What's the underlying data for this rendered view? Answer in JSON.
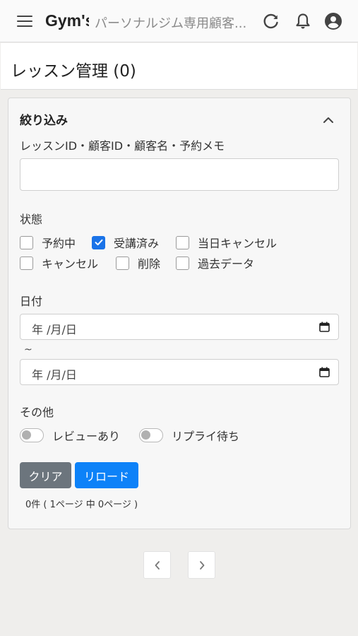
{
  "header": {
    "brand": "Gym's",
    "subtitle": "パーソナルジム専用顧客...",
    "icons": [
      "menu-icon",
      "reload-icon",
      "bell-icon",
      "account-icon"
    ]
  },
  "page": {
    "title": "レッスン管理 (0)"
  },
  "filter": {
    "heading": "絞り込み",
    "search_label": "レッスンID・顧客ID・顧客名・予約メモ",
    "search_value": "",
    "status_label": "状態",
    "statuses": [
      {
        "label": "予約中",
        "checked": false
      },
      {
        "label": "受講済み",
        "checked": true
      },
      {
        "label": "当日キャンセル",
        "checked": false
      },
      {
        "label": "キャンセル",
        "checked": false
      },
      {
        "label": "削除",
        "checked": false
      },
      {
        "label": "過去データ",
        "checked": false
      }
    ],
    "date_label": "日付",
    "date_from_placeholder": "年 /月/日",
    "date_separator": "~",
    "date_to_placeholder": "年 /月/日",
    "other_label": "その他",
    "toggles": [
      {
        "label": "レビューあり",
        "on": false
      },
      {
        "label": "リプライ待ち",
        "on": false
      }
    ],
    "clear_button": "クリア",
    "reload_button": "リロード",
    "count_text": "0件 ( 1ページ 中 0ページ )"
  },
  "pagination": {
    "prev_icon": "chevron-left-icon",
    "next_icon": "chevron-right-icon"
  },
  "colors": {
    "accent": "#1a73e8",
    "reload_button": "#0d82f8",
    "clear_button": "#6c757d",
    "background": "#efeeec"
  }
}
